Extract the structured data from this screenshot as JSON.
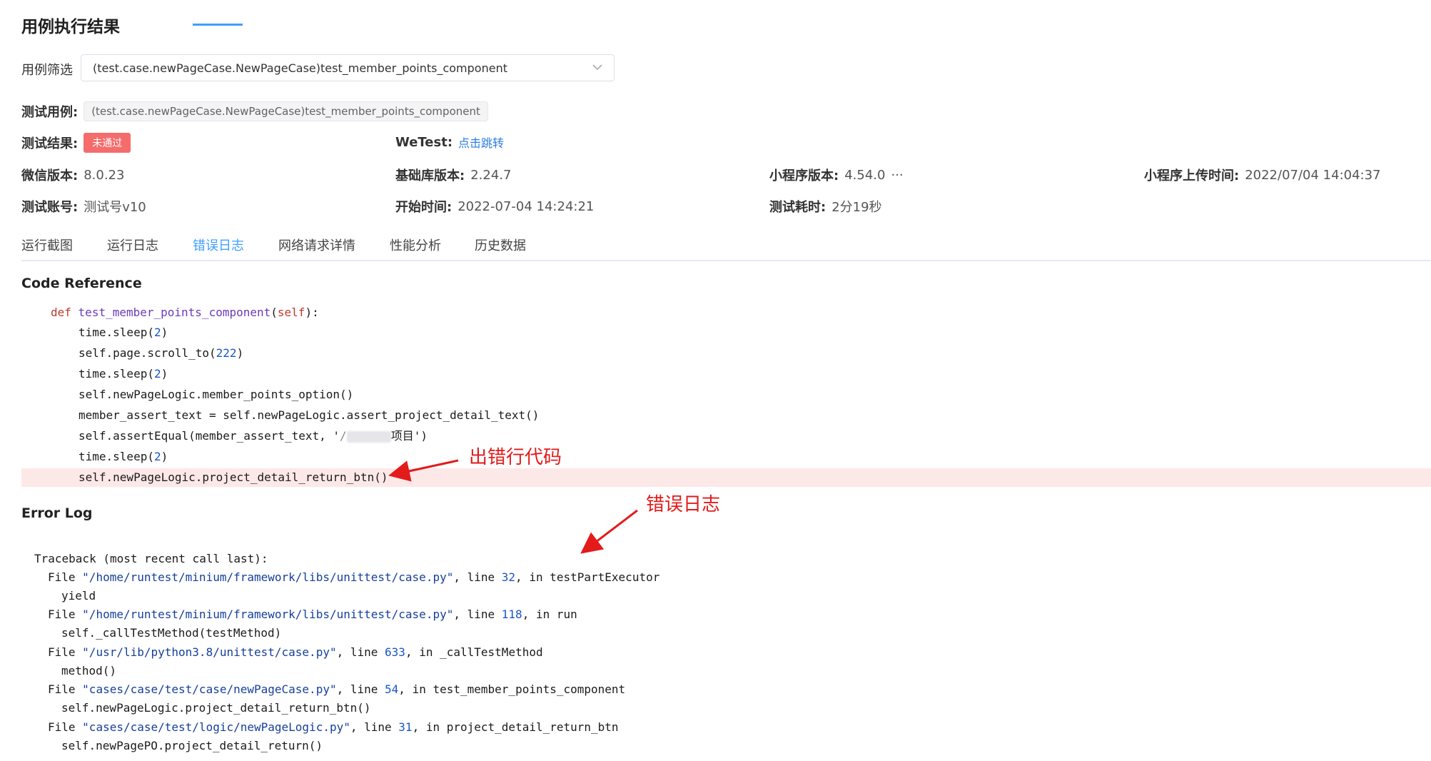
{
  "page_title": "用例执行结果",
  "filter": {
    "label": "用例筛选",
    "selected": "(test.case.newPageCase.NewPageCase)test_member_points_component"
  },
  "info": {
    "case_label": "测试用例:",
    "case_value": "(test.case.newPageCase.NewPageCase)test_member_points_component",
    "result_label": "测试结果:",
    "result_value": "未通过",
    "wetest_label": "WeTest:",
    "wetest_link": "点击跳转",
    "wechat_version_label": "微信版本:",
    "wechat_version_value": "8.0.23",
    "base_lib_label": "基础库版本:",
    "base_lib_value": "2.24.7",
    "mini_version_label": "小程序版本:",
    "mini_version_value": "4.54.0",
    "mini_version_more": "···",
    "upload_time_label": "小程序上传时间:",
    "upload_time_value": "2022/07/04 14:04:37",
    "account_label": "测试账号:",
    "account_value": "测试号v10",
    "start_time_label": "开始时间:",
    "start_time_value": "2022-07-04 14:24:21",
    "duration_label": "测试耗时:",
    "duration_value": "2分19秒"
  },
  "tabs": [
    {
      "label": "运行截图"
    },
    {
      "label": "运行日志"
    },
    {
      "label": "错误日志"
    },
    {
      "label": "网络请求详情"
    },
    {
      "label": "性能分析"
    },
    {
      "label": "历史数据"
    }
  ],
  "active_tab": "错误日志",
  "code_reference": {
    "title": "Code Reference",
    "def_keyword": "def",
    "func_name": "test_member_points_component",
    "self_arg": "self",
    "lines": [
      "time.sleep(2)",
      "self.page.scroll_to(222)",
      "time.sleep(2)",
      "self.newPageLogic.member_points_option()",
      "member_assert_text = self.newPageLogic.assert_project_detail_text()",
      "self.assertEqual(member_assert_text, '",
      "time.sleep(2)",
      "self.newPageLogic.project_detail_return_btn()"
    ],
    "assert_tail_visible": "项目')",
    "assert_prefix_visible": "/"
  },
  "error_log": {
    "title": "Error Log",
    "traceback_header": "Traceback (most recent call last):",
    "frames": [
      {
        "file": "\"/home/runtest/minium/framework/libs/unittest/case.py\"",
        "line": "32",
        "func": "testPartExecutor",
        "code": "yield"
      },
      {
        "file": "\"/home/runtest/minium/framework/libs/unittest/case.py\"",
        "line": "118",
        "func": "run",
        "code": "self._callTestMethod(testMethod)"
      },
      {
        "file": "\"/usr/lib/python3.8/unittest/case.py\"",
        "line": "633",
        "func": "_callTestMethod",
        "code": "method()"
      },
      {
        "file": "\"cases/case/test/case/newPageCase.py\"",
        "line": "54",
        "func": "test_member_points_component",
        "code": "self.newPageLogic.project_detail_return_btn()"
      },
      {
        "file": "\"cases/case/test/logic/newPageLogic.py\"",
        "line": "31",
        "func": "project_detail_return_btn",
        "code": "self.newPagePO.project_detail_return()"
      }
    ],
    "file_kw": "File",
    "line_kw": "line",
    "in_kw": "in"
  },
  "annotations": {
    "error_line": "出错行代码",
    "error_log": "错误日志",
    "color": "#e31b1b"
  },
  "colors": {
    "accent": "#409eff",
    "fail_badge": "#f56c6c",
    "error_row_bg": "#fde8e8"
  }
}
